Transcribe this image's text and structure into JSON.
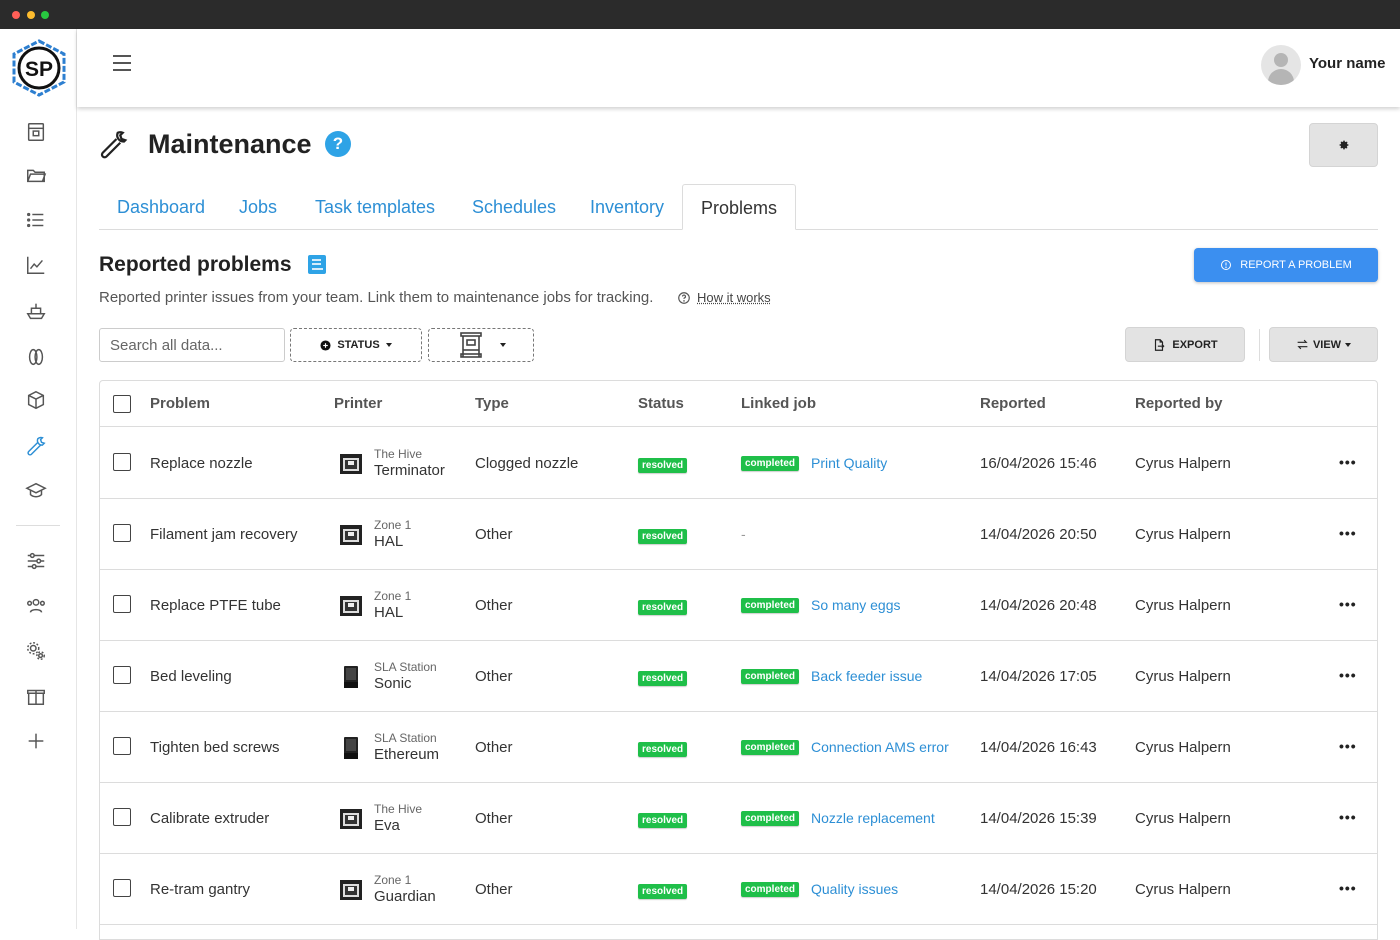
{
  "topbar": {
    "username": "Your name"
  },
  "sidebar": {
    "logo_text": "SP",
    "items": [
      {
        "icon": "printer-icon"
      },
      {
        "icon": "folder-icon"
      },
      {
        "icon": "list-icon"
      },
      {
        "icon": "chart-icon"
      },
      {
        "icon": "ship-icon"
      },
      {
        "icon": "spool-icon"
      },
      {
        "icon": "box-icon"
      },
      {
        "icon": "wrench-icon",
        "active": true
      },
      {
        "icon": "graduation-cap-icon"
      },
      {
        "icon": "sliders-icon"
      },
      {
        "icon": "users-icon"
      },
      {
        "icon": "gears-icon"
      },
      {
        "icon": "gift-icon"
      },
      {
        "icon": "plus-icon"
      }
    ]
  },
  "page": {
    "title": "Maintenance",
    "help": "?",
    "tabs": [
      "Dashboard",
      "Jobs",
      "Task templates",
      "Schedules",
      "Inventory",
      "Problems"
    ],
    "active_tab": "Problems"
  },
  "section": {
    "title": "Reported problems",
    "subtitle": "Reported printer issues from your team. Link them to maintenance jobs for tracking.",
    "how_it_works": "How it works",
    "report_button": "REPORT A PROBLEM"
  },
  "toolbar": {
    "search_placeholder": "Search all data...",
    "status_filter": "STATUS",
    "export": "EXPORT",
    "view": "VIEW"
  },
  "table": {
    "headers": [
      "Problem",
      "Printer",
      "Type",
      "Status",
      "Linked job",
      "Reported",
      "Reported by"
    ],
    "rows": [
      {
        "problem": "Replace nozzle",
        "printer_group": "The Hive",
        "printer_name": "Terminator",
        "printer_kind": "fdm",
        "type": "Clogged nozzle",
        "status": "resolved",
        "job_status": "completed",
        "job": "Print Quality",
        "reported": "16/04/2026 15:46",
        "reported_by": "Cyrus Halpern"
      },
      {
        "problem": "Filament jam recovery",
        "printer_group": "Zone 1",
        "printer_name": "HAL",
        "printer_kind": "fdm",
        "type": "Other",
        "status": "resolved",
        "job_status": "",
        "job": "-",
        "reported": "14/04/2026 20:50",
        "reported_by": "Cyrus Halpern"
      },
      {
        "problem": "Replace PTFE tube",
        "printer_group": "Zone 1",
        "printer_name": "HAL",
        "printer_kind": "fdm",
        "type": "Other",
        "status": "resolved",
        "job_status": "completed",
        "job": "So many eggs",
        "reported": "14/04/2026 20:48",
        "reported_by": "Cyrus Halpern"
      },
      {
        "problem": "Bed leveling",
        "printer_group": "SLA Station",
        "printer_name": "Sonic",
        "printer_kind": "sla",
        "type": "Other",
        "status": "resolved",
        "job_status": "completed",
        "job": "Back feeder issue",
        "reported": "14/04/2026 17:05",
        "reported_by": "Cyrus Halpern"
      },
      {
        "problem": "Tighten bed screws",
        "printer_group": "SLA Station",
        "printer_name": "Ethereum",
        "printer_kind": "sla",
        "type": "Other",
        "status": "resolved",
        "job_status": "completed",
        "job": "Connection AMS error",
        "reported": "14/04/2026 16:43",
        "reported_by": "Cyrus Halpern"
      },
      {
        "problem": "Calibrate extruder",
        "printer_group": "The Hive",
        "printer_name": "Eva",
        "printer_kind": "fdm",
        "type": "Other",
        "status": "resolved",
        "job_status": "completed",
        "job": "Nozzle replacement",
        "reported": "14/04/2026 15:39",
        "reported_by": "Cyrus Halpern"
      },
      {
        "problem": "Re-tram gantry",
        "printer_group": "Zone 1",
        "printer_name": "Guardian",
        "printer_kind": "fdm",
        "type": "Other",
        "status": "resolved",
        "job_status": "completed",
        "job": "Quality issues",
        "reported": "14/04/2026 15:20",
        "reported_by": "Cyrus Halpern"
      }
    ],
    "row_action": "•••"
  },
  "colors": {
    "accent": "#2d8fd5",
    "primary_button": "#3b8ff0",
    "badge_green": "#1fbf49"
  }
}
